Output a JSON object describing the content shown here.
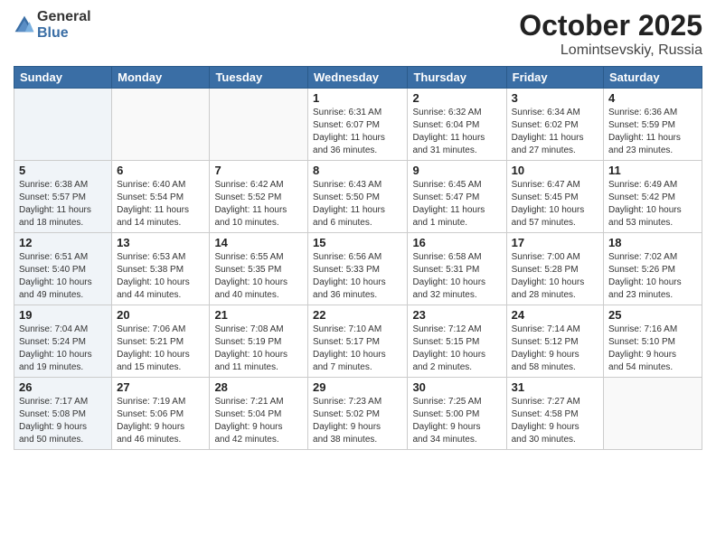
{
  "logo": {
    "general": "General",
    "blue": "Blue"
  },
  "title": "October 2025",
  "location": "Lomintsevskiy, Russia",
  "days_of_week": [
    "Sunday",
    "Monday",
    "Tuesday",
    "Wednesday",
    "Thursday",
    "Friday",
    "Saturday"
  ],
  "weeks": [
    [
      {
        "day": "",
        "info": ""
      },
      {
        "day": "",
        "info": ""
      },
      {
        "day": "",
        "info": ""
      },
      {
        "day": "1",
        "info": "Sunrise: 6:31 AM\nSunset: 6:07 PM\nDaylight: 11 hours\nand 36 minutes."
      },
      {
        "day": "2",
        "info": "Sunrise: 6:32 AM\nSunset: 6:04 PM\nDaylight: 11 hours\nand 31 minutes."
      },
      {
        "day": "3",
        "info": "Sunrise: 6:34 AM\nSunset: 6:02 PM\nDaylight: 11 hours\nand 27 minutes."
      },
      {
        "day": "4",
        "info": "Sunrise: 6:36 AM\nSunset: 5:59 PM\nDaylight: 11 hours\nand 23 minutes."
      }
    ],
    [
      {
        "day": "5",
        "info": "Sunrise: 6:38 AM\nSunset: 5:57 PM\nDaylight: 11 hours\nand 18 minutes."
      },
      {
        "day": "6",
        "info": "Sunrise: 6:40 AM\nSunset: 5:54 PM\nDaylight: 11 hours\nand 14 minutes."
      },
      {
        "day": "7",
        "info": "Sunrise: 6:42 AM\nSunset: 5:52 PM\nDaylight: 11 hours\nand 10 minutes."
      },
      {
        "day": "8",
        "info": "Sunrise: 6:43 AM\nSunset: 5:50 PM\nDaylight: 11 hours\nand 6 minutes."
      },
      {
        "day": "9",
        "info": "Sunrise: 6:45 AM\nSunset: 5:47 PM\nDaylight: 11 hours\nand 1 minute."
      },
      {
        "day": "10",
        "info": "Sunrise: 6:47 AM\nSunset: 5:45 PM\nDaylight: 10 hours\nand 57 minutes."
      },
      {
        "day": "11",
        "info": "Sunrise: 6:49 AM\nSunset: 5:42 PM\nDaylight: 10 hours\nand 53 minutes."
      }
    ],
    [
      {
        "day": "12",
        "info": "Sunrise: 6:51 AM\nSunset: 5:40 PM\nDaylight: 10 hours\nand 49 minutes."
      },
      {
        "day": "13",
        "info": "Sunrise: 6:53 AM\nSunset: 5:38 PM\nDaylight: 10 hours\nand 44 minutes."
      },
      {
        "day": "14",
        "info": "Sunrise: 6:55 AM\nSunset: 5:35 PM\nDaylight: 10 hours\nand 40 minutes."
      },
      {
        "day": "15",
        "info": "Sunrise: 6:56 AM\nSunset: 5:33 PM\nDaylight: 10 hours\nand 36 minutes."
      },
      {
        "day": "16",
        "info": "Sunrise: 6:58 AM\nSunset: 5:31 PM\nDaylight: 10 hours\nand 32 minutes."
      },
      {
        "day": "17",
        "info": "Sunrise: 7:00 AM\nSunset: 5:28 PM\nDaylight: 10 hours\nand 28 minutes."
      },
      {
        "day": "18",
        "info": "Sunrise: 7:02 AM\nSunset: 5:26 PM\nDaylight: 10 hours\nand 23 minutes."
      }
    ],
    [
      {
        "day": "19",
        "info": "Sunrise: 7:04 AM\nSunset: 5:24 PM\nDaylight: 10 hours\nand 19 minutes."
      },
      {
        "day": "20",
        "info": "Sunrise: 7:06 AM\nSunset: 5:21 PM\nDaylight: 10 hours\nand 15 minutes."
      },
      {
        "day": "21",
        "info": "Sunrise: 7:08 AM\nSunset: 5:19 PM\nDaylight: 10 hours\nand 11 minutes."
      },
      {
        "day": "22",
        "info": "Sunrise: 7:10 AM\nSunset: 5:17 PM\nDaylight: 10 hours\nand 7 minutes."
      },
      {
        "day": "23",
        "info": "Sunrise: 7:12 AM\nSunset: 5:15 PM\nDaylight: 10 hours\nand 2 minutes."
      },
      {
        "day": "24",
        "info": "Sunrise: 7:14 AM\nSunset: 5:12 PM\nDaylight: 9 hours\nand 58 minutes."
      },
      {
        "day": "25",
        "info": "Sunrise: 7:16 AM\nSunset: 5:10 PM\nDaylight: 9 hours\nand 54 minutes."
      }
    ],
    [
      {
        "day": "26",
        "info": "Sunrise: 7:17 AM\nSunset: 5:08 PM\nDaylight: 9 hours\nand 50 minutes."
      },
      {
        "day": "27",
        "info": "Sunrise: 7:19 AM\nSunset: 5:06 PM\nDaylight: 9 hours\nand 46 minutes."
      },
      {
        "day": "28",
        "info": "Sunrise: 7:21 AM\nSunset: 5:04 PM\nDaylight: 9 hours\nand 42 minutes."
      },
      {
        "day": "29",
        "info": "Sunrise: 7:23 AM\nSunset: 5:02 PM\nDaylight: 9 hours\nand 38 minutes."
      },
      {
        "day": "30",
        "info": "Sunrise: 7:25 AM\nSunset: 5:00 PM\nDaylight: 9 hours\nand 34 minutes."
      },
      {
        "day": "31",
        "info": "Sunrise: 7:27 AM\nSunset: 4:58 PM\nDaylight: 9 hours\nand 30 minutes."
      },
      {
        "day": "",
        "info": ""
      }
    ]
  ]
}
